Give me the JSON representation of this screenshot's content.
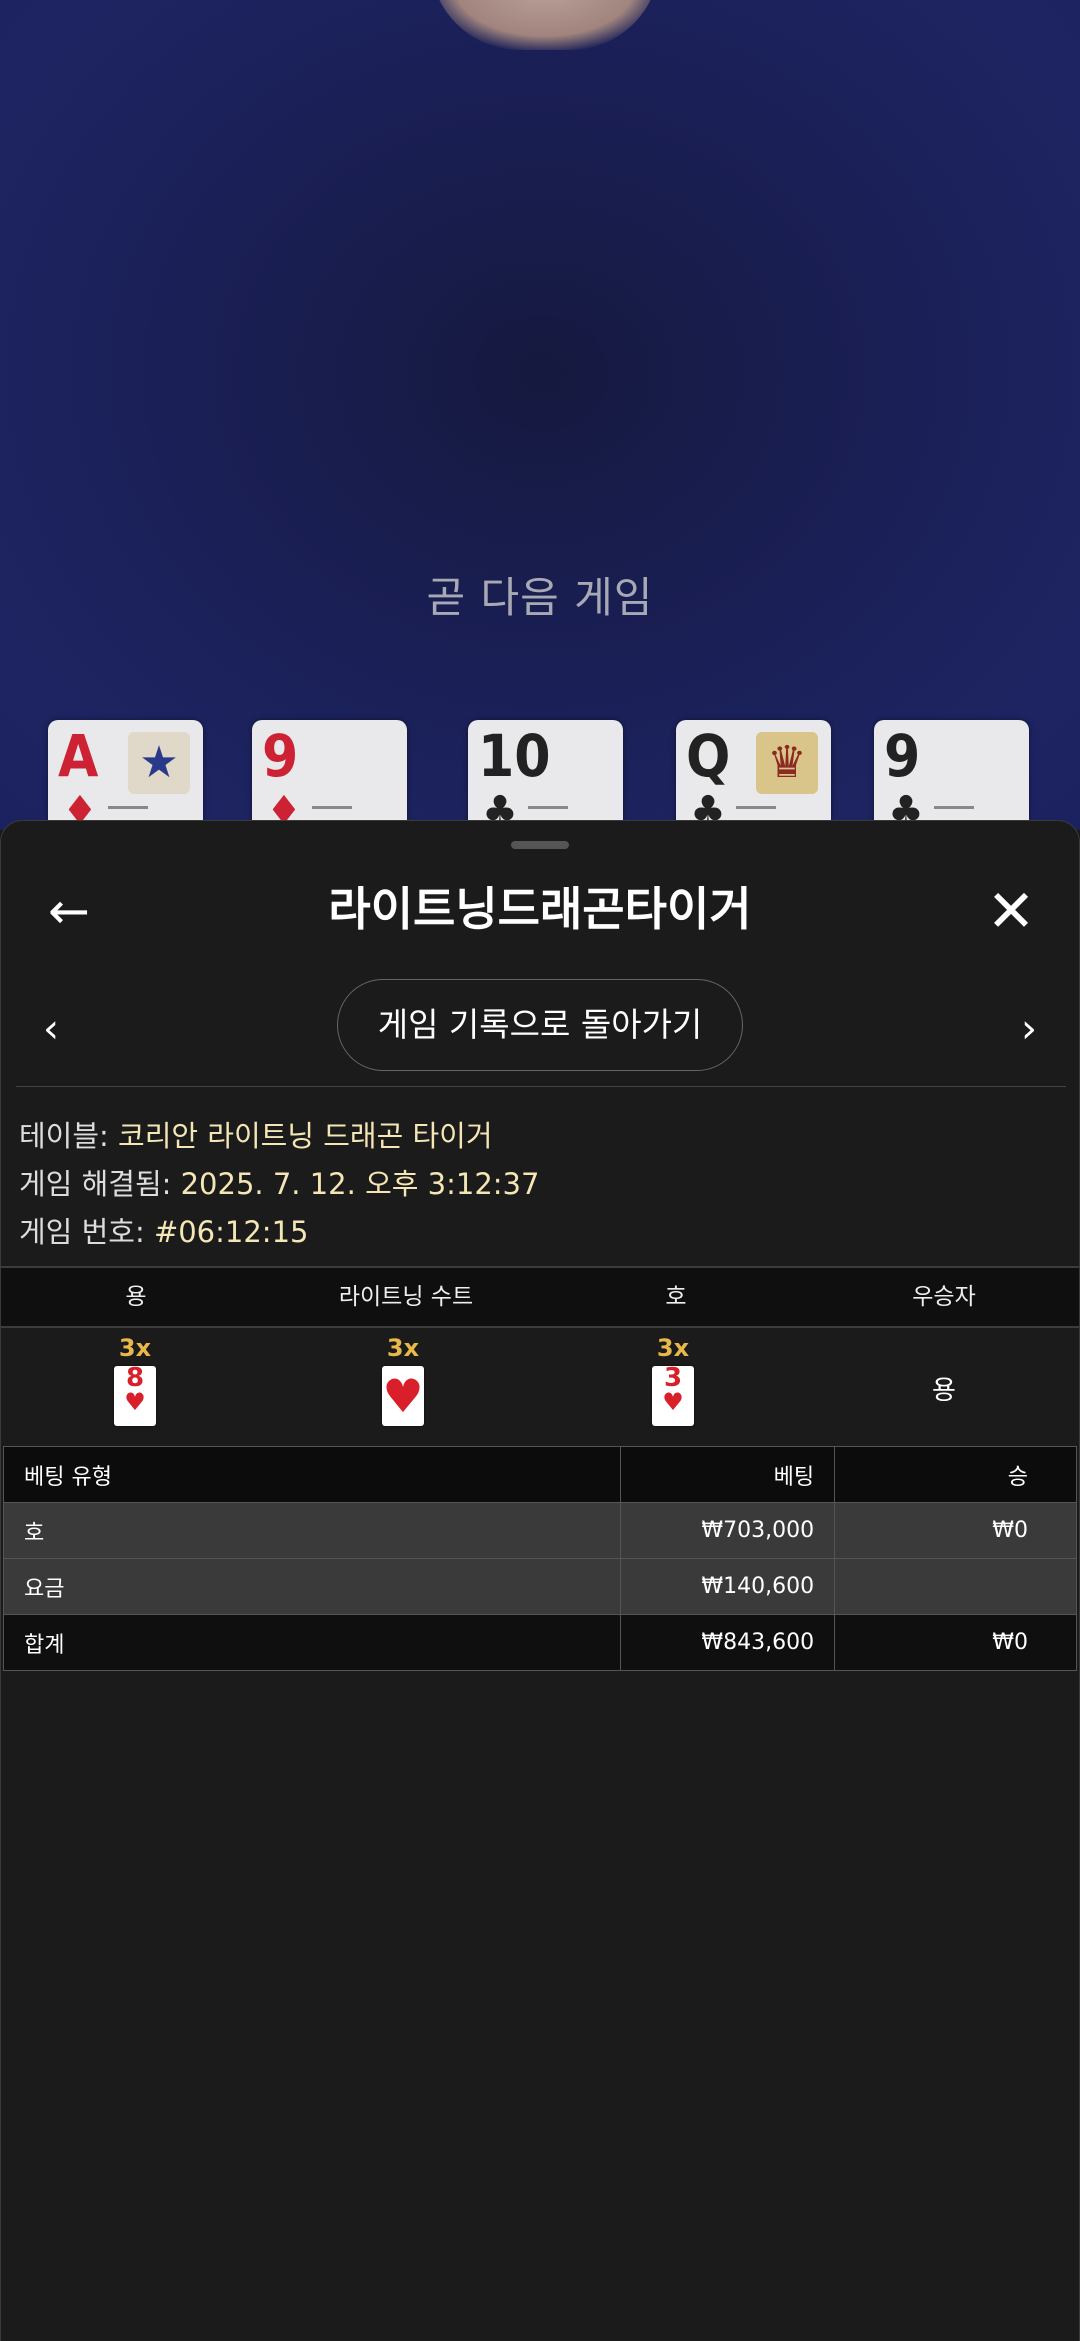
{
  "background": {
    "next_game_text": "곧 다음 게임",
    "cards": [
      {
        "rank": "A",
        "suit": "♦",
        "color": "red",
        "face": "★"
      },
      {
        "rank": "9",
        "suit": "♦",
        "color": "red",
        "face": ""
      },
      {
        "rank": "10",
        "suit": "♣",
        "color": "black",
        "face": ""
      },
      {
        "rank": "Q",
        "suit": "♣",
        "color": "black",
        "face": "♛"
      },
      {
        "rank": "9",
        "suit": "♣",
        "color": "black",
        "face": ""
      }
    ]
  },
  "sheet": {
    "title": "라이트닝드래곤타이거",
    "back_icon": "←",
    "close_icon": "✕",
    "prev_icon": "‹",
    "next_icon": "›",
    "history_button": "게임 기록으로 돌아가기",
    "info": {
      "table_label": "테이블:",
      "table_value": "코리안 라이트닝 드래곤 타이거",
      "resolved_label": "게임 해결됨:",
      "resolved_value": "2025. 7. 12. 오후 3:12:37",
      "number_label": "게임 번호:",
      "number_value": "#06:12:15"
    },
    "round": {
      "headers": [
        "용",
        "라이트닝 수트",
        "호",
        "우승자"
      ],
      "dragon": {
        "mult": "3x",
        "rank": "8",
        "suit": "♥"
      },
      "lightning_suit": {
        "mult": "3x",
        "suit": "♥"
      },
      "tiger": {
        "mult": "3x",
        "rank": "3",
        "suit": "♥"
      },
      "winner": "용"
    },
    "bets": {
      "headers": {
        "type": "베팅 유형",
        "bet": "베팅",
        "win": "승"
      },
      "rows": [
        {
          "type": "호",
          "bet": "₩703,000",
          "win": "₩0"
        },
        {
          "type": "요금",
          "bet": "₩140,600",
          "win": ""
        }
      ],
      "total": {
        "type": "합계",
        "bet": "₩843,600",
        "win": "₩0"
      }
    }
  }
}
